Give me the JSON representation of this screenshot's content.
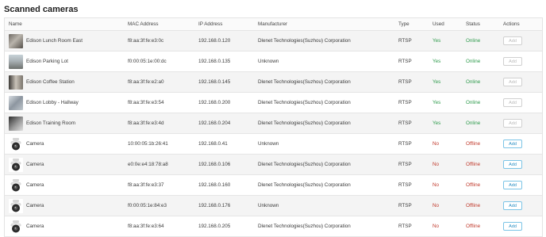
{
  "title": "Scanned cameras",
  "columns": [
    "Name",
    "MAC Address",
    "IP Address",
    "Manufacturer",
    "Type",
    "Used",
    "Status",
    "Actions"
  ],
  "rows": [
    {
      "name": "Edison Lunch Room East",
      "mac": "f8:aa:3f:fe:e3:0c",
      "ip": "192.168.0.120",
      "manufacturer": "Dlenet Technologies(Suzhou) Corporation",
      "type": "RTSP",
      "used": "Yes",
      "status": "Online",
      "action": "Add",
      "action_enabled": false,
      "thumbnail": "camera-snapshot"
    },
    {
      "name": "Edison Parking Lot",
      "mac": "f0:00:05:1e:00:dc",
      "ip": "192.168.0.135",
      "manufacturer": "Unknown",
      "type": "RTSP",
      "used": "Yes",
      "status": "Online",
      "action": "Add",
      "action_enabled": false,
      "thumbnail": "camera-snapshot"
    },
    {
      "name": "Edison Coffee Station",
      "mac": "f8:aa:3f:fe:e2:a0",
      "ip": "192.168.0.145",
      "manufacturer": "Dlenet Technologies(Suzhou) Corporation",
      "type": "RTSP",
      "used": "Yes",
      "status": "Online",
      "action": "Add",
      "action_enabled": false,
      "thumbnail": "camera-snapshot"
    },
    {
      "name": "Edison Lobby - Hallway",
      "mac": "f8:aa:3f:fe:e3:54",
      "ip": "192.168.0.200",
      "manufacturer": "Dlenet Technologies(Suzhou) Corporation",
      "type": "RTSP",
      "used": "Yes",
      "status": "Online",
      "action": "Add",
      "action_enabled": false,
      "thumbnail": "camera-snapshot"
    },
    {
      "name": "Edison Training Room",
      "mac": "f8:aa:3f:fe:e3:4d",
      "ip": "192.168.0.204",
      "manufacturer": "Dlenet Technologies(Suzhou) Corporation",
      "type": "RTSP",
      "used": "Yes",
      "status": "Online",
      "action": "Add",
      "action_enabled": false,
      "thumbnail": "camera-snapshot"
    },
    {
      "name": "Camera",
      "mac": "10:00:05:1b:26:41",
      "ip": "192.168.0.41",
      "manufacturer": "Unknown",
      "type": "RTSP",
      "used": "No",
      "status": "Offline",
      "action": "Add",
      "action_enabled": true,
      "thumbnail": "dome-camera-icon"
    },
    {
      "name": "Camera",
      "mac": "e0:0e:e4:18:78:a8",
      "ip": "192.168.0.106",
      "manufacturer": "Dlenet Technologies(Suzhou) Corporation",
      "type": "RTSP",
      "used": "No",
      "status": "Offline",
      "action": "Add",
      "action_enabled": true,
      "thumbnail": "dome-camera-icon"
    },
    {
      "name": "Camera",
      "mac": "f8:aa:3f:fe:e3:37",
      "ip": "192.168.0.160",
      "manufacturer": "Dlenet Technologies(Suzhou) Corporation",
      "type": "RTSP",
      "used": "No",
      "status": "Offline",
      "action": "Add",
      "action_enabled": true,
      "thumbnail": "dome-camera-icon"
    },
    {
      "name": "Camera",
      "mac": "f0:00:05:1e:84:e3",
      "ip": "192.168.0.176",
      "manufacturer": "Unknown",
      "type": "RTSP",
      "used": "No",
      "status": "Offline",
      "action": "Add",
      "action_enabled": true,
      "thumbnail": "dome-camera-icon"
    },
    {
      "name": "Camera",
      "mac": "f8:aa:3f:fe:e3:64",
      "ip": "192.168.0.205",
      "manufacturer": "Dlenet Technologies(Suzhou) Corporation",
      "type": "RTSP",
      "used": "No",
      "status": "Offline",
      "action": "Add",
      "action_enabled": true,
      "thumbnail": "dome-camera-icon"
    }
  ],
  "colors": {
    "yes": "#2e9b4c",
    "no": "#c0392b",
    "online": "#2e9b4c",
    "offline": "#c0392b",
    "add_button": "#2a8fc4"
  }
}
